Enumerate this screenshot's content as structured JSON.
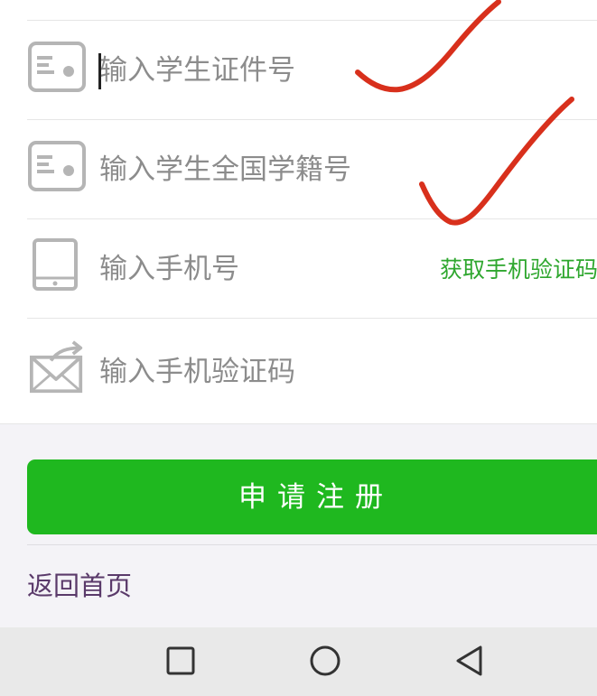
{
  "form": {
    "student_id": {
      "placeholder": "输入学生证件号",
      "value": ""
    },
    "national_id": {
      "placeholder": "输入学生全国学籍号",
      "value": ""
    },
    "phone": {
      "placeholder": "输入手机号",
      "value": "",
      "get_code_label": "获取手机验证码"
    },
    "sms_code": {
      "placeholder": "输入手机验证码",
      "value": ""
    }
  },
  "register_button": {
    "label": "申请注册"
  },
  "back_home_link": {
    "label": "返回首页"
  },
  "colors": {
    "accent_green": "#1fb81f",
    "link_green": "#2fa72f",
    "back_link_purple": "#5a3a6a",
    "annotation_red": "#d8301c"
  },
  "icons": {
    "student_id": "id-card-icon",
    "national_id": "id-card-icon",
    "phone": "tablet-phone-icon",
    "sms_code": "envelope-arrow-icon",
    "nav_recent": "square-recent-apps-icon",
    "nav_home": "circle-home-icon",
    "nav_back": "triangle-back-icon"
  }
}
